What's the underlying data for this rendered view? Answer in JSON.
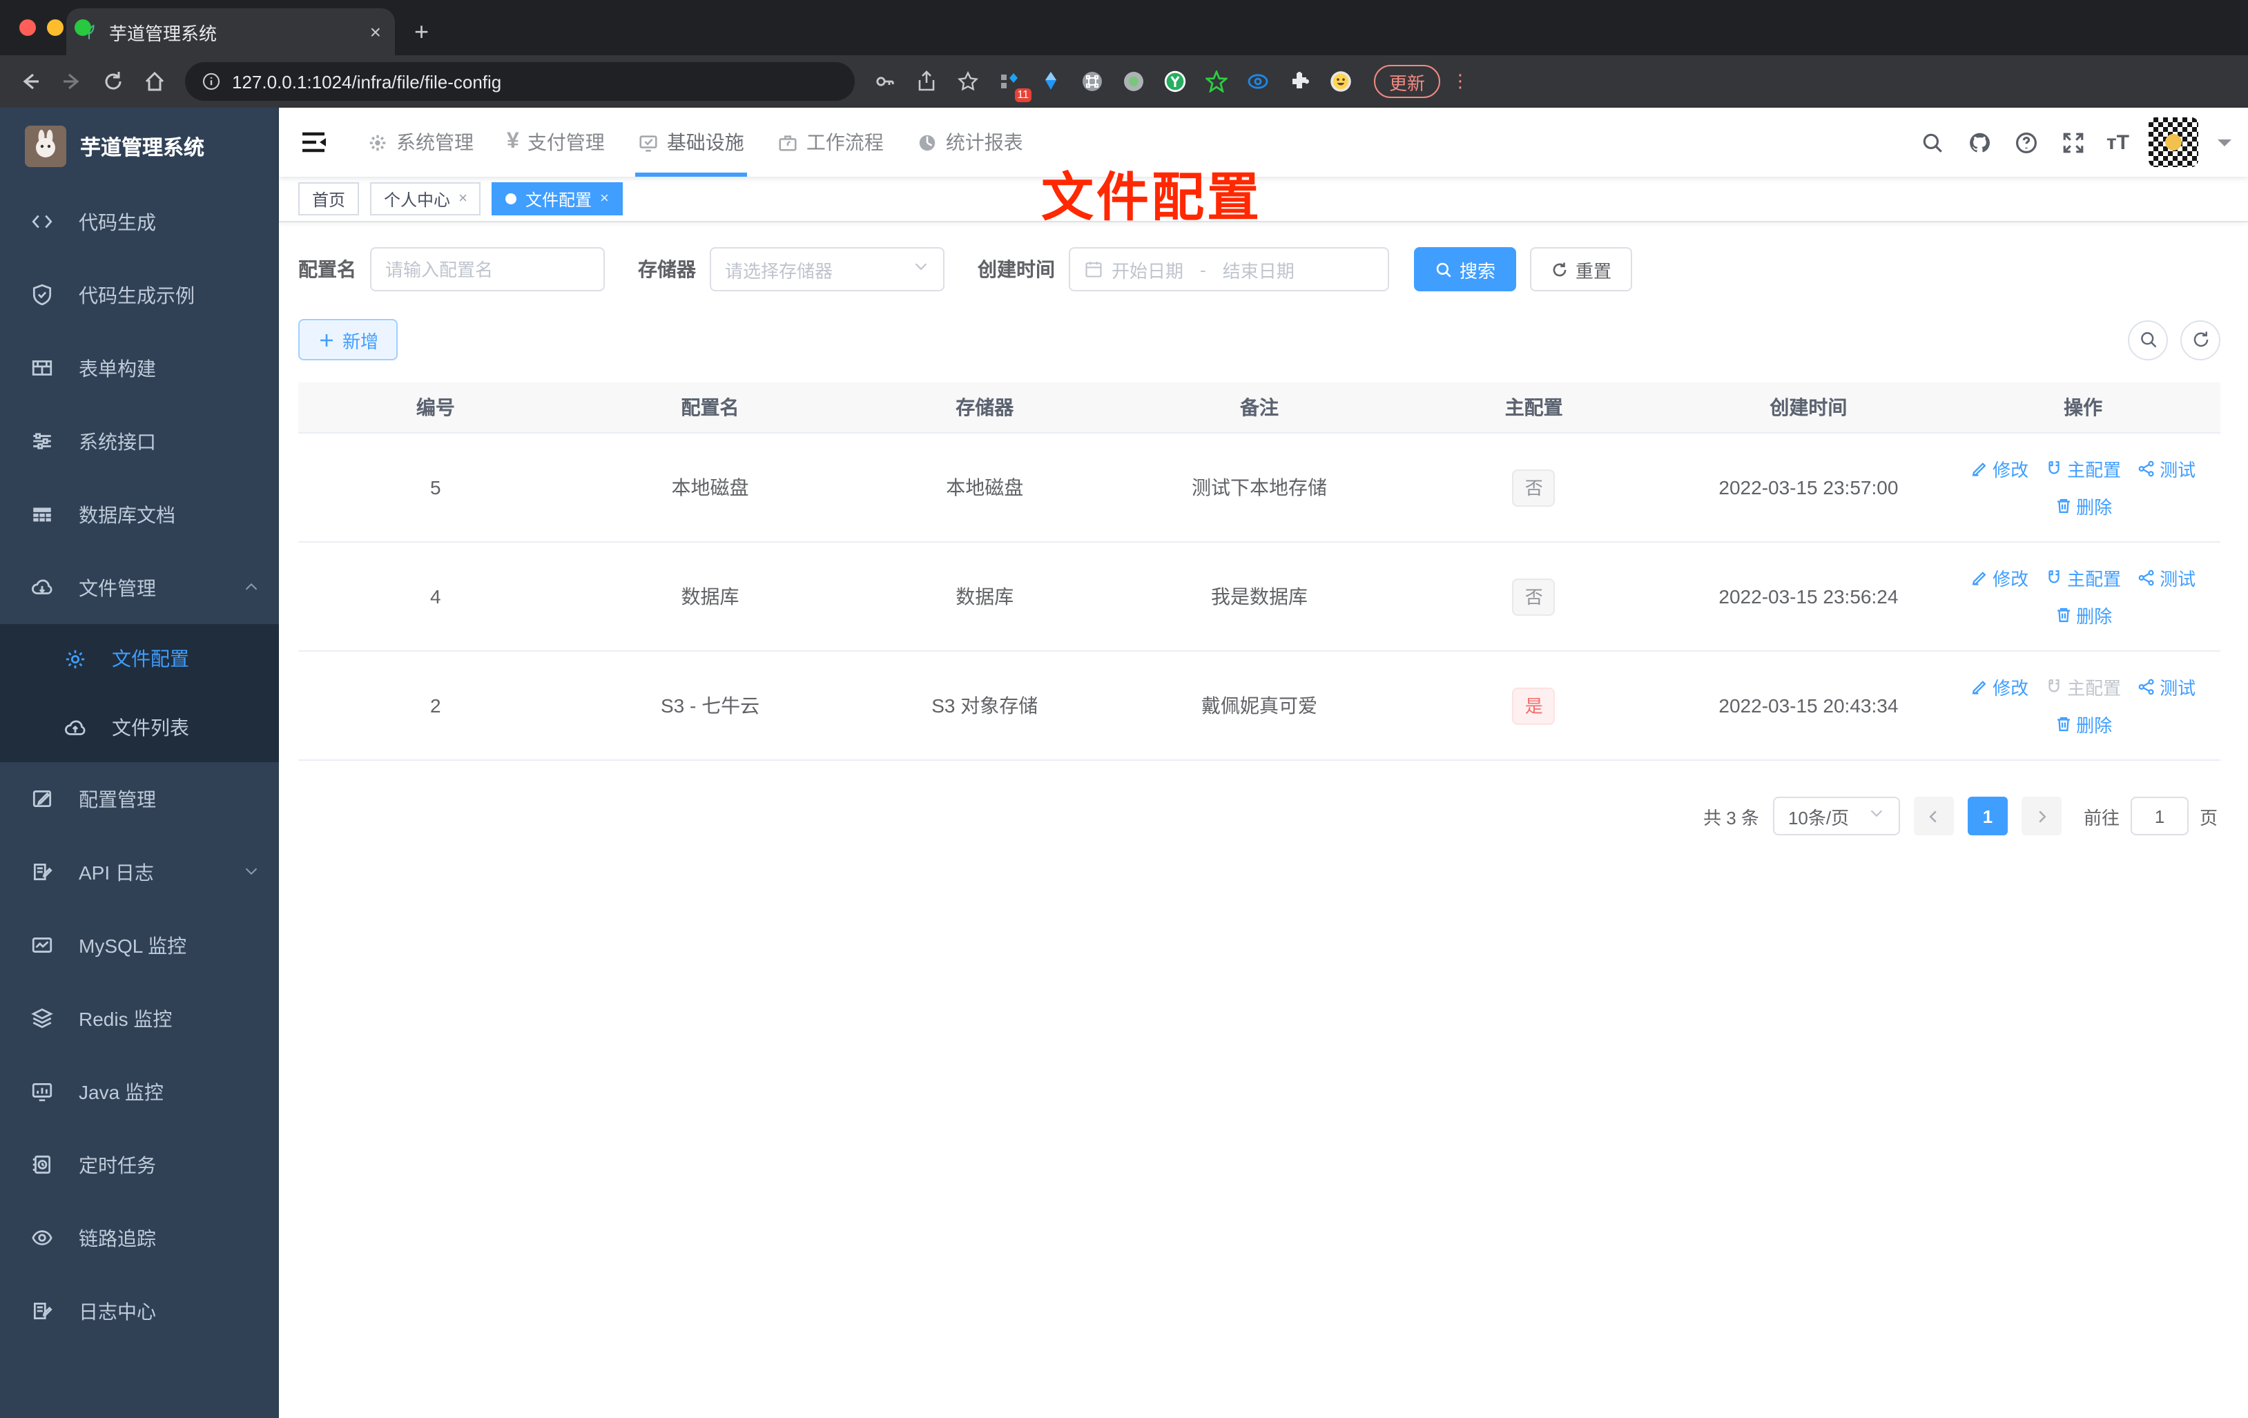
{
  "browser": {
    "tab_title": "芋道管理系统",
    "tab_close": "×",
    "new_tab": "+",
    "url": "127.0.0.1:1024/infra/file/file-config",
    "extension_badge": "11",
    "update_label": "更新",
    "kebab": "⋮"
  },
  "sidebar": {
    "logo_title": "芋道管理系统",
    "items": [
      {
        "label": "代码生成"
      },
      {
        "label": "代码生成示例"
      },
      {
        "label": "表单构建"
      },
      {
        "label": "系统接口"
      },
      {
        "label": "数据库文档"
      },
      {
        "label": "文件管理"
      },
      {
        "label": "文件配置"
      },
      {
        "label": "文件列表"
      },
      {
        "label": "配置管理"
      },
      {
        "label": "API 日志"
      },
      {
        "label": "MySQL 监控"
      },
      {
        "label": "Redis 监控"
      },
      {
        "label": "Java 监控"
      },
      {
        "label": "定时任务"
      },
      {
        "label": "链路追踪"
      },
      {
        "label": "日志中心"
      }
    ]
  },
  "topnav": {
    "items": [
      {
        "label": "系统管理"
      },
      {
        "label": "支付管理",
        "glyph": "¥"
      },
      {
        "label": "基础设施"
      },
      {
        "label": "工作流程"
      },
      {
        "label": "统计报表"
      }
    ]
  },
  "tags": [
    {
      "label": "首页"
    },
    {
      "label": "个人中心",
      "close": "×"
    },
    {
      "label": "文件配置",
      "close": "×"
    }
  ],
  "annotation_title": "文件配置",
  "filters": {
    "config_name_label": "配置名",
    "config_name_placeholder": "请输入配置名",
    "storage_label": "存储器",
    "storage_placeholder": "请选择存储器",
    "create_time_label": "创建时间",
    "start_date_placeholder": "开始日期",
    "range_separator": "-",
    "end_date_placeholder": "结束日期",
    "search_button": "搜索",
    "reset_button": "重置"
  },
  "toolbar": {
    "add_button": "新增"
  },
  "table": {
    "headers": [
      "编号",
      "配置名",
      "存储器",
      "备注",
      "主配置",
      "创建时间",
      "操作"
    ],
    "action_labels": {
      "edit": "修改",
      "master": "主配置",
      "test": "测试",
      "delete": "删除"
    },
    "rows": [
      {
        "no": "5",
        "name": "本地磁盘",
        "storage": "本地磁盘",
        "remark": "测试下本地存储",
        "master": "否",
        "created": "2022-03-15 23:57:00"
      },
      {
        "no": "4",
        "name": "数据库",
        "storage": "数据库",
        "remark": "我是数据库",
        "master": "否",
        "created": "2022-03-15 23:56:24"
      },
      {
        "no": "2",
        "name": "S3 - 七牛云",
        "storage": "S3 对象存储",
        "remark": "戴佩妮真可爱",
        "master": "是",
        "created": "2022-03-15 20:43:34"
      }
    ]
  },
  "pagination": {
    "total": "共 3 条",
    "page_size": "10条/页",
    "current": "1",
    "goto_label": "前往",
    "goto_value": "1",
    "page_unit": "页"
  },
  "colors": {
    "primary": "#409eff",
    "danger": "#f56c6c",
    "sidebar": "#304156",
    "annotation_red": "#ff2800"
  }
}
